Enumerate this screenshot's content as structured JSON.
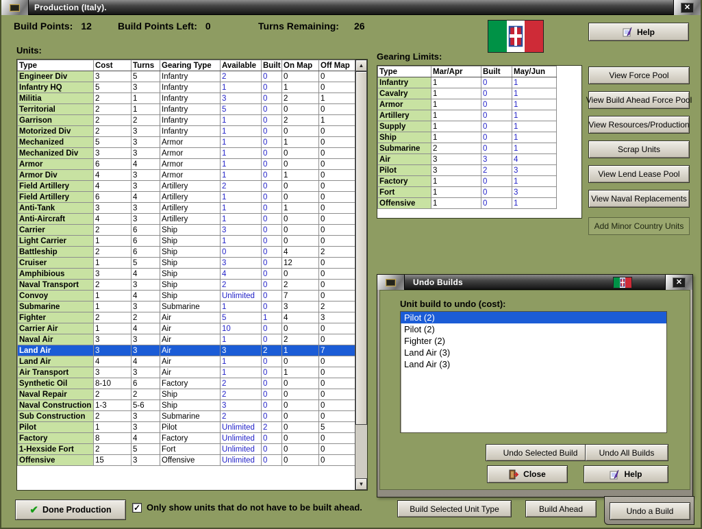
{
  "window": {
    "title": "Production (Italy)."
  },
  "header": {
    "build_points": {
      "label": "Build Points:",
      "value": "12"
    },
    "build_points_left": {
      "label": "Build Points Left:",
      "value": "0"
    },
    "turns_remaining": {
      "label": "Turns Remaining:",
      "value": "26"
    },
    "help_button": "Help"
  },
  "units_table": {
    "label": "Units:",
    "columns": [
      "Type",
      "Cost",
      "Turns",
      "Gearing Type",
      "Available",
      "Built",
      "On Map",
      "Off Map"
    ],
    "selected_row": 25,
    "rows": [
      [
        "Engineer Div",
        "3",
        "5",
        "Infantry",
        "2",
        "0",
        "0",
        "0"
      ],
      [
        "Infantry HQ",
        "5",
        "3",
        "Infantry",
        "1",
        "0",
        "1",
        "0"
      ],
      [
        "Militia",
        "2",
        "1",
        "Infantry",
        "3",
        "0",
        "2",
        "1"
      ],
      [
        "Territorial",
        "2",
        "1",
        "Infantry",
        "5",
        "0",
        "0",
        "0"
      ],
      [
        "Garrison",
        "2",
        "2",
        "Infantry",
        "1",
        "0",
        "2",
        "1"
      ],
      [
        "Motorized Div",
        "2",
        "3",
        "Infantry",
        "1",
        "0",
        "0",
        "0"
      ],
      [
        "Mechanized",
        "5",
        "3",
        "Armor",
        "1",
        "0",
        "1",
        "0"
      ],
      [
        "Mechanized Div",
        "3",
        "3",
        "Armor",
        "1",
        "0",
        "0",
        "0"
      ],
      [
        "Armor",
        "6",
        "4",
        "Armor",
        "1",
        "0",
        "0",
        "0"
      ],
      [
        "Armor Div",
        "4",
        "3",
        "Armor",
        "1",
        "0",
        "1",
        "0"
      ],
      [
        "Field Artillery",
        "4",
        "3",
        "Artillery",
        "2",
        "0",
        "0",
        "0"
      ],
      [
        "Field Artillery",
        "6",
        "4",
        "Artillery",
        "1",
        "0",
        "0",
        "0"
      ],
      [
        "Anti-Tank",
        "3",
        "3",
        "Artillery",
        "1",
        "0",
        "1",
        "0"
      ],
      [
        "Anti-Aircraft",
        "4",
        "3",
        "Artillery",
        "1",
        "0",
        "0",
        "0"
      ],
      [
        "Carrier",
        "2",
        "6",
        "Ship",
        "3",
        "0",
        "0",
        "0"
      ],
      [
        "Light Carrier",
        "1",
        "6",
        "Ship",
        "1",
        "0",
        "0",
        "0"
      ],
      [
        "Battleship",
        "2",
        "6",
        "Ship",
        "0",
        "0",
        "4",
        "2"
      ],
      [
        "Cruiser",
        "1",
        "5",
        "Ship",
        "3",
        "0",
        "12",
        "0"
      ],
      [
        "Amphibious",
        "3",
        "4",
        "Ship",
        "4",
        "0",
        "0",
        "0"
      ],
      [
        "Naval Transport",
        "2",
        "3",
        "Ship",
        "2",
        "0",
        "2",
        "0"
      ],
      [
        "Convoy",
        "1",
        "4",
        "Ship",
        "Unlimited",
        "0",
        "7",
        "0"
      ],
      [
        "Submarine",
        "1",
        "3",
        "Submarine",
        "1",
        "0",
        "3",
        "2"
      ],
      [
        "Fighter",
        "2",
        "2",
        "Air",
        "5",
        "1",
        "4",
        "3"
      ],
      [
        "Carrier Air",
        "1",
        "4",
        "Air",
        "10",
        "0",
        "0",
        "0"
      ],
      [
        "Naval Air",
        "3",
        "3",
        "Air",
        "1",
        "0",
        "2",
        "0"
      ],
      [
        "Land Air",
        "3",
        "3",
        "Air",
        "3",
        "2",
        "1",
        "7"
      ],
      [
        "Land Air",
        "4",
        "4",
        "Air",
        "1",
        "0",
        "0",
        "0"
      ],
      [
        "Air Transport",
        "3",
        "3",
        "Air",
        "1",
        "0",
        "1",
        "0"
      ],
      [
        "Synthetic Oil",
        "8-10",
        "6",
        "Factory",
        "2",
        "0",
        "0",
        "0"
      ],
      [
        "Naval Repair",
        "2",
        "2",
        "Ship",
        "2",
        "0",
        "0",
        "0"
      ],
      [
        "Naval Construction",
        "1-3",
        "5-6",
        "Ship",
        "3",
        "0",
        "0",
        "0"
      ],
      [
        "Sub Construction",
        "2",
        "3",
        "Submarine",
        "2",
        "0",
        "0",
        "0"
      ],
      [
        "Pilot",
        "1",
        "3",
        "Pilot",
        "Unlimited",
        "2",
        "0",
        "5"
      ],
      [
        "Factory",
        "8",
        "4",
        "Factory",
        "Unlimited",
        "0",
        "0",
        "0"
      ],
      [
        "1-Hexside Fort",
        "2",
        "5",
        "Fort",
        "Unlimited",
        "0",
        "0",
        "0"
      ],
      [
        "Offensive",
        "15",
        "3",
        "Offensive",
        "Unlimited",
        "0",
        "0",
        "0"
      ]
    ]
  },
  "gearing_table": {
    "label": "Gearing Limits:",
    "columns": [
      "Type",
      "Mar/Apr",
      "Built",
      "May/Jun"
    ],
    "rows": [
      [
        "Infantry",
        "1",
        "0",
        "1"
      ],
      [
        "Cavalry",
        "1",
        "0",
        "1"
      ],
      [
        "Armor",
        "1",
        "0",
        "1"
      ],
      [
        "Artillery",
        "1",
        "0",
        "1"
      ],
      [
        "Supply",
        "1",
        "0",
        "1"
      ],
      [
        "Ship",
        "1",
        "0",
        "1"
      ],
      [
        "Submarine",
        "2",
        "0",
        "1"
      ],
      [
        "Air",
        "3",
        "3",
        "4"
      ],
      [
        "Pilot",
        "3",
        "2",
        "3"
      ],
      [
        "Factory",
        "1",
        "0",
        "1"
      ],
      [
        "Fort",
        "1",
        "0",
        "3"
      ],
      [
        "Offensive",
        "1",
        "0",
        "1"
      ]
    ]
  },
  "side_buttons": [
    "View Force Pool",
    "View Build Ahead Force Pool",
    "View Resources/Production",
    "Scrap Units",
    "View Lend Lease Pool",
    "View Naval Replacements",
    "Add Minor Country Units"
  ],
  "undo_dialog": {
    "title": "Undo Builds",
    "prompt": "Unit build to undo (cost):",
    "selected_item": 0,
    "items": [
      "Pilot (2)",
      "Pilot (2)",
      "Fighter (2)",
      "Land Air (3)",
      "Land Air (3)"
    ],
    "undo_selected_button": "Undo Selected Build",
    "undo_all_button": "Undo All Builds",
    "close_button": "Close",
    "help_button": "Help"
  },
  "bottom_bar": {
    "done_button": "Done Production",
    "filter_checkbox": {
      "checked": true,
      "label": "Only show units that do not have to be built ahead."
    },
    "build_selected_button": "Build Selected Unit Type",
    "build_ahead_button": "Build Ahead",
    "undo_build_button": "Undo a Build"
  },
  "icons": {
    "close_x": "✕",
    "scroll_up": "▲",
    "scroll_down": "▼",
    "checkbox_check": "✓",
    "done_check": "✔"
  },
  "colors": {
    "background": "#8e9c62",
    "type_cell_green": "#c8e2a2",
    "selection_blue": "#1b5cd6",
    "value_blue": "#2222c8",
    "flag_green": "#009246",
    "flag_red": "#ce2b37"
  }
}
